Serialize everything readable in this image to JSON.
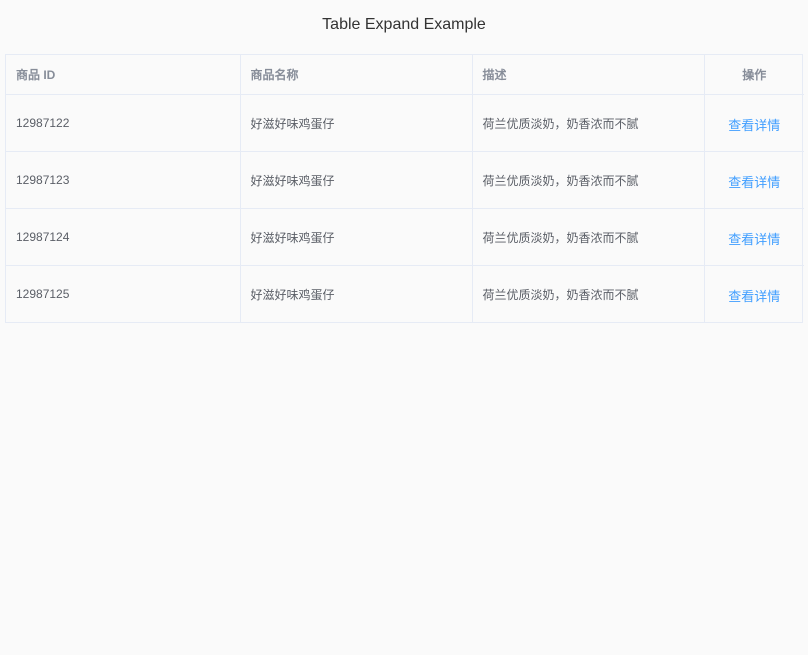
{
  "title": "Table Expand Example",
  "table": {
    "headers": {
      "id": "商品 ID",
      "name": "商品名称",
      "desc": "描述",
      "op": "操作"
    },
    "rows": [
      {
        "id": "12987122",
        "name": "好滋好味鸡蛋仔",
        "desc": "荷兰优质淡奶，奶香浓而不腻",
        "action": "查看详情"
      },
      {
        "id": "12987123",
        "name": "好滋好味鸡蛋仔",
        "desc": "荷兰优质淡奶，奶香浓而不腻",
        "action": "查看详情"
      },
      {
        "id": "12987124",
        "name": "好滋好味鸡蛋仔",
        "desc": "荷兰优质淡奶，奶香浓而不腻",
        "action": "查看详情"
      },
      {
        "id": "12987125",
        "name": "好滋好味鸡蛋仔",
        "desc": "荷兰优质淡奶，奶香浓而不腻",
        "action": "查看详情"
      }
    ]
  },
  "colors": {
    "link": "#409eff",
    "border": "#e6ebf5",
    "header_text": "#878d99",
    "cell_text": "#5a5e66",
    "background": "#fafafa"
  }
}
